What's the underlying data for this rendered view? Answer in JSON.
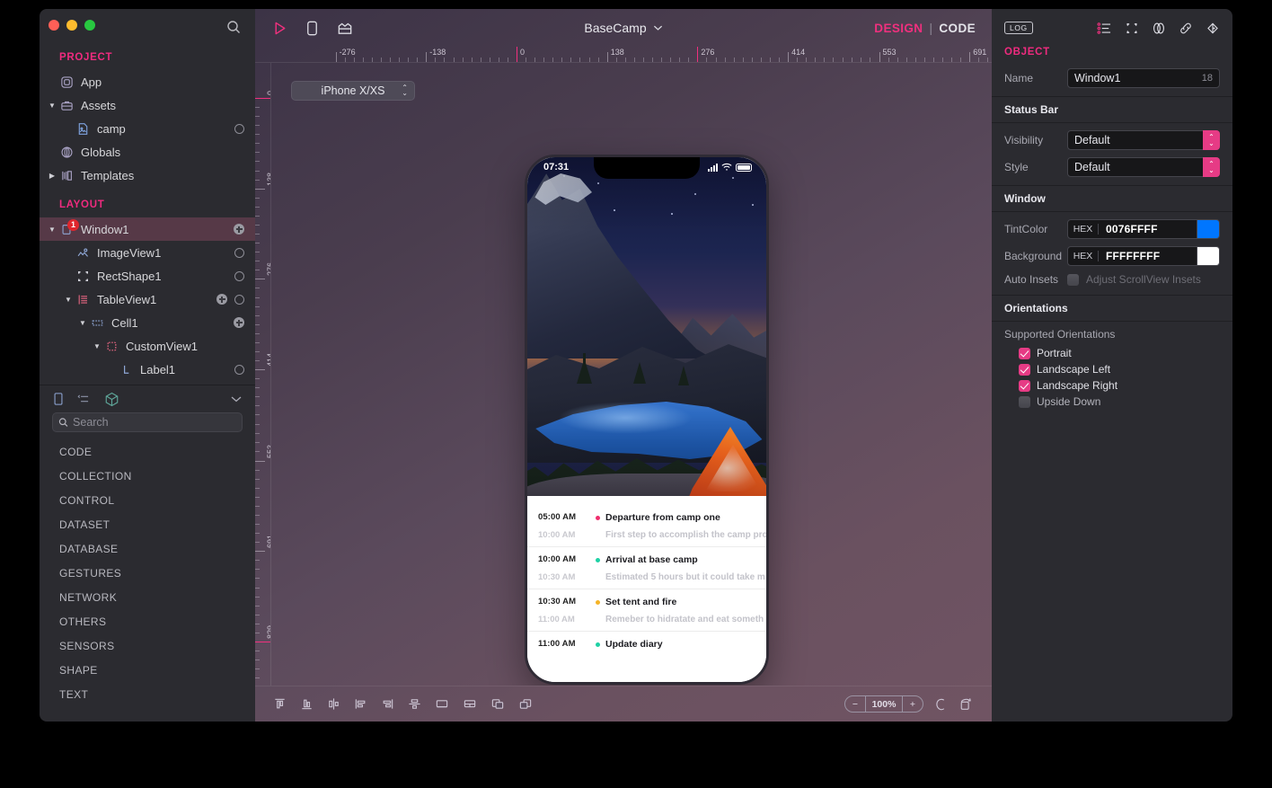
{
  "window": {
    "title": "BaseCamp",
    "mode": {
      "design": "DESIGN",
      "separator": "|",
      "code": "CODE"
    }
  },
  "sidebar": {
    "search_icon": "search-icon",
    "project": {
      "header": "PROJECT",
      "items": [
        {
          "label": "App",
          "icon": "app-icon",
          "depth": 1,
          "disclosure": "",
          "trailing": ""
        },
        {
          "label": "Assets",
          "icon": "briefcase-icon",
          "depth": 1,
          "disclosure": "down",
          "trailing": ""
        },
        {
          "label": "camp",
          "icon": "image-file-icon",
          "depth": 2,
          "disclosure": "",
          "trailing": "circle"
        },
        {
          "label": "Globals",
          "icon": "globals-icon",
          "depth": 1,
          "disclosure": "",
          "trailing": ""
        },
        {
          "label": "Templates",
          "icon": "templates-icon",
          "depth": 1,
          "disclosure": "right",
          "trailing": ""
        }
      ]
    },
    "layout": {
      "header": "LAYOUT",
      "items": [
        {
          "label": "Window1",
          "icon": "window-icon",
          "depth": 1,
          "disclosure": "down",
          "trailing": "plus",
          "selected": true,
          "badge": "1"
        },
        {
          "label": "ImageView1",
          "icon": "imageview-icon",
          "depth": 2,
          "disclosure": "",
          "trailing": "circle"
        },
        {
          "label": "RectShape1",
          "icon": "rectshape-icon",
          "depth": 2,
          "disclosure": "",
          "trailing": "circle"
        },
        {
          "label": "TableView1",
          "icon": "tableview-icon",
          "depth": 2,
          "disclosure": "down",
          "trailing": "plus-circle"
        },
        {
          "label": "Cell1",
          "icon": "cell-icon",
          "depth": 3,
          "disclosure": "down",
          "trailing": "plus"
        },
        {
          "label": "CustomView1",
          "icon": "customview-icon",
          "depth": 4,
          "disclosure": "down",
          "trailing": ""
        },
        {
          "label": "Label1",
          "icon": "label-icon",
          "depth": 5,
          "disclosure": "",
          "trailing": "circle"
        }
      ]
    },
    "panel_tabs": [
      {
        "name": "device-panel-icon"
      },
      {
        "name": "list-panel-icon"
      },
      {
        "name": "cube-panel-icon"
      },
      {
        "name": "chevron-down-icon"
      }
    ],
    "search": {
      "placeholder": "Search",
      "value": ""
    },
    "categories": [
      "CODE",
      "COLLECTION",
      "CONTROL",
      "DATASET",
      "DATABASE",
      "GESTURES",
      "NETWORK",
      "OTHERS",
      "SENSORS",
      "SHAPE",
      "TEXT"
    ]
  },
  "canvas": {
    "toolbar_icons": [
      "run-icon",
      "device-icon",
      "layout-icon"
    ],
    "device_selector": "iPhone X/XS",
    "ruler_h": [
      "-276",
      "-138",
      "0",
      "138",
      "276",
      "414",
      "553",
      "691"
    ],
    "ruler_v": [
      "0",
      "138",
      "276",
      "414",
      "553",
      "691",
      "829"
    ],
    "zoom": {
      "minus": "−",
      "value": "100%",
      "plus": "+"
    },
    "bottom_icons": [
      "align-top-icon",
      "align-bottom-icon",
      "align-vertical-center-icon",
      "align-left-icon",
      "align-right-icon",
      "align-horizontal-center-icon",
      "distribute-icon",
      "group-icon",
      "bring-forward-icon",
      "send-backward-icon"
    ],
    "zoom_side_icons": [
      "pan-icon",
      "rotate-icon"
    ]
  },
  "preview": {
    "status_bar": {
      "time": "07:31",
      "signal": "signal-icon",
      "wifi": "wifi-icon",
      "battery": "battery-icon"
    },
    "image": "camp-tent-mountain-lake-photo",
    "timeline": [
      {
        "time_start": "05:00 AM",
        "time_end": "10:00 AM",
        "title": "Departure from camp one",
        "subtitle": "First step to accomplish the camp pro",
        "color": "#ef2e6d"
      },
      {
        "time_start": "10:00 AM",
        "time_end": "10:30 AM",
        "title": "Arrival at base camp",
        "subtitle": "Estimated 5 hours but it could take m",
        "color": "#1fd1a5"
      },
      {
        "time_start": "10:30 AM",
        "time_end": "11:00 AM",
        "title": "Set tent and fire",
        "subtitle": "Remeber to hidratate and eat someth",
        "color": "#f5b427"
      },
      {
        "time_start": "11:00 AM",
        "time_end": "",
        "title": "Update diary",
        "subtitle": "",
        "color": "#1fd1a5"
      }
    ]
  },
  "inspector": {
    "log_label": "LOG",
    "top_icons": [
      "properties-list-icon",
      "frame-icon",
      "appearance-icon",
      "link-icon",
      "events-icon"
    ],
    "object_header": "OBJECT",
    "name": {
      "label": "Name",
      "value": "Window1",
      "count": "18"
    },
    "status_bar": {
      "header": "Status Bar",
      "visibility": {
        "label": "Visibility",
        "value": "Default"
      },
      "style": {
        "label": "Style",
        "value": "Default"
      }
    },
    "window": {
      "header": "Window",
      "tint_color": {
        "label": "TintColor",
        "tag": "HEX",
        "value": "0076FFFF",
        "swatch": "#0076FF"
      },
      "background": {
        "label": "Background",
        "tag": "HEX",
        "value": "FFFFFFFF",
        "swatch": "#FFFFFF"
      },
      "auto_insets": {
        "label": "Auto Insets",
        "checkbox_label": "Adjust ScrollView Insets",
        "checked": false
      }
    },
    "orientations": {
      "header": "Orientations",
      "sub_label": "Supported Orientations",
      "items": [
        {
          "label": "Portrait",
          "checked": true
        },
        {
          "label": "Landscape Left",
          "checked": true
        },
        {
          "label": "Landscape Right",
          "checked": true
        },
        {
          "label": "Upside Down",
          "checked": false
        }
      ]
    }
  },
  "colors": {
    "accent_pink": "#f02b7f",
    "selection": "#563947",
    "sidebar_bg": "#2b2b30"
  }
}
